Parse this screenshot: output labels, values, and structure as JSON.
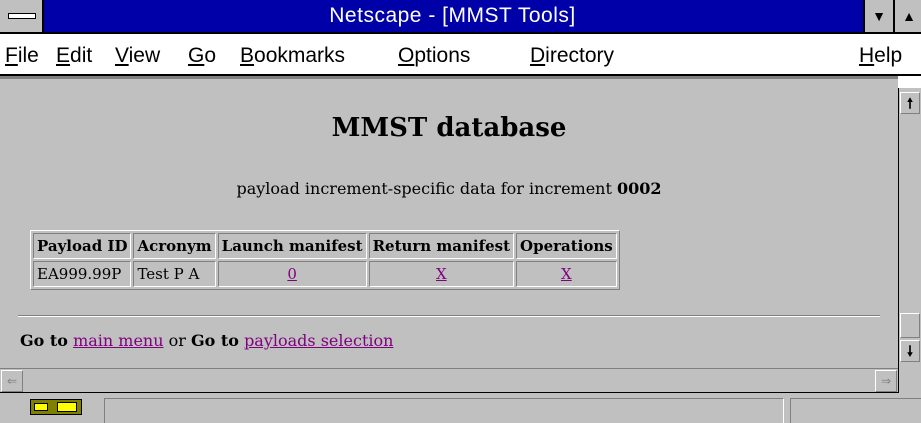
{
  "window": {
    "title": "Netscape - [MMST Tools]"
  },
  "menu": [
    {
      "label": "File",
      "u": "F",
      "rest": "ile"
    },
    {
      "label": "Edit",
      "u": "E",
      "rest": "dit"
    },
    {
      "label": "View",
      "u": "V",
      "rest": "iew"
    },
    {
      "label": "Go",
      "u": "G",
      "rest": "o"
    },
    {
      "label": "Bookmarks",
      "u": "B",
      "rest": "ookmarks"
    },
    {
      "label": "Options",
      "u": "O",
      "rest": "ptions"
    },
    {
      "label": "Directory",
      "u": "D",
      "rest": "irectory"
    },
    {
      "label": "Help",
      "u": "H",
      "rest": "elp"
    }
  ],
  "page": {
    "heading": "MMST database",
    "subtitle_prefix": "payload increment-specific data for increment ",
    "increment": "0002",
    "table": {
      "headers": [
        "Payload ID",
        "Acronym",
        "Launch manifest",
        "Return manifest",
        "Operations"
      ],
      "rows": [
        [
          "EA999.99P",
          "Test P A",
          "0",
          "X",
          "X"
        ]
      ]
    },
    "footer": {
      "goto1": "Go to",
      "link1": "main menu",
      "or": "or",
      "goto2": "Go to",
      "link2": "payloads selection"
    }
  },
  "colors": {
    "titlebar": "#0000a8",
    "chrome": "#c0c0c0",
    "visited_link": "#800080"
  }
}
